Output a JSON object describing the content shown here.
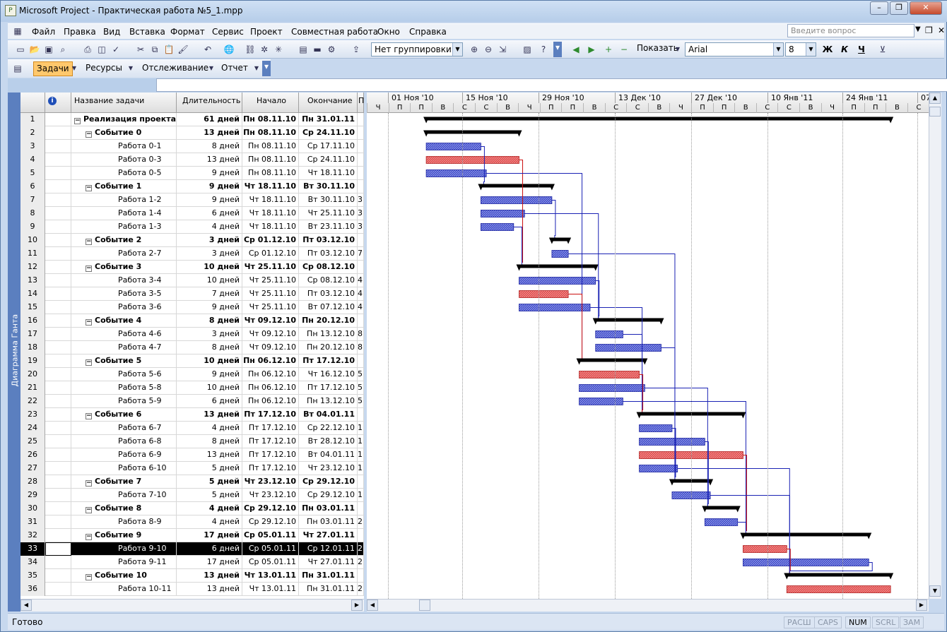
{
  "window": {
    "title": "Microsoft Project - Практическая работа №5_1.mpp",
    "min": "–",
    "restore": "❐",
    "close": "✕"
  },
  "menu": {
    "items": [
      "Файл",
      "Правка",
      "Вид",
      "Вставка",
      "Формат",
      "Сервис",
      "Проект",
      "Совместная работа",
      "Окно",
      "Справка"
    ],
    "help_placeholder": "Введите вопрос"
  },
  "toolbar": {
    "grouping": "Нет группировки",
    "show_label": "Показать",
    "font": "Arial",
    "size": "8",
    "bold": "Ж",
    "italic": "К",
    "underline": "Ч"
  },
  "toolbar2": {
    "tasks": "Задачи",
    "resources": "Ресурсы",
    "tracking": "Отслеживание",
    "report": "Отчет"
  },
  "side_label": "Диаграмма Ганта",
  "columns": {
    "info": "i",
    "name": "Название задачи",
    "duration": "Длительность",
    "start": "Начало",
    "finish": "Окончание",
    "pred": "П"
  },
  "timescale": {
    "weeks": [
      "01 Ноя '10",
      "15 Ноя '10",
      "29 Ноя '10",
      "13 Дек '10",
      "27 Дек '10",
      "10 Янв '11",
      "24 Янв '11",
      "07"
    ],
    "days": [
      "Ч",
      "П",
      "П",
      "В",
      "С",
      "С",
      "В",
      "Ч",
      "П",
      "П",
      "В",
      "С",
      "С",
      "В",
      "Ч",
      "П",
      "П",
      "В",
      "С",
      "С",
      "В",
      "Ч",
      "П",
      "П",
      "В",
      "С"
    ]
  },
  "tasks": [
    {
      "id": "1",
      "name": "Реализация проекта",
      "dur": "61 дней",
      "start": "Пн 08.11.10",
      "end": "Пн 31.01.11",
      "pred": "",
      "level": 0,
      "summary": true
    },
    {
      "id": "2",
      "name": "Событие 0",
      "dur": "13 дней",
      "start": "Пн 08.11.10",
      "end": "Ср 24.11.10",
      "pred": "",
      "level": 1,
      "summary": true
    },
    {
      "id": "3",
      "name": "Работа 0-1",
      "dur": "8 дней",
      "start": "Пн 08.11.10",
      "end": "Ср 17.11.10",
      "pred": "",
      "level": 2,
      "summary": false
    },
    {
      "id": "4",
      "name": "Работа 0-3",
      "dur": "13 дней",
      "start": "Пн 08.11.10",
      "end": "Ср 24.11.10",
      "pred": "",
      "level": 2,
      "summary": false
    },
    {
      "id": "5",
      "name": "Работа 0-5",
      "dur": "9 дней",
      "start": "Пн 08.11.10",
      "end": "Чт 18.11.10",
      "pred": "",
      "level": 2,
      "summary": false
    },
    {
      "id": "6",
      "name": "Событие 1",
      "dur": "9 дней",
      "start": "Чт 18.11.10",
      "end": "Вт 30.11.10",
      "pred": "",
      "level": 1,
      "summary": true
    },
    {
      "id": "7",
      "name": "Работа 1-2",
      "dur": "9 дней",
      "start": "Чт 18.11.10",
      "end": "Вт 30.11.10",
      "pred": "3",
      "level": 2,
      "summary": false
    },
    {
      "id": "8",
      "name": "Работа 1-4",
      "dur": "6 дней",
      "start": "Чт 18.11.10",
      "end": "Чт 25.11.10",
      "pred": "3",
      "level": 2,
      "summary": false
    },
    {
      "id": "9",
      "name": "Работа 1-3",
      "dur": "4 дней",
      "start": "Чт 18.11.10",
      "end": "Вт 23.11.10",
      "pred": "3",
      "level": 2,
      "summary": false
    },
    {
      "id": "10",
      "name": "Событие 2",
      "dur": "3 дней",
      "start": "Ср 01.12.10",
      "end": "Пт 03.12.10",
      "pred": "",
      "level": 1,
      "summary": true
    },
    {
      "id": "11",
      "name": "Работа 2-7",
      "dur": "3 дней",
      "start": "Ср 01.12.10",
      "end": "Пт 03.12.10",
      "pred": "7",
      "level": 2,
      "summary": false
    },
    {
      "id": "12",
      "name": "Событие 3",
      "dur": "10 дней",
      "start": "Чт 25.11.10",
      "end": "Ср 08.12.10",
      "pred": "",
      "level": 1,
      "summary": true
    },
    {
      "id": "13",
      "name": "Работа 3-4",
      "dur": "10 дней",
      "start": "Чт 25.11.10",
      "end": "Ср 08.12.10",
      "pred": "4",
      "level": 2,
      "summary": false
    },
    {
      "id": "14",
      "name": "Работа 3-5",
      "dur": "7 дней",
      "start": "Чт 25.11.10",
      "end": "Пт 03.12.10",
      "pred": "4",
      "level": 2,
      "summary": false
    },
    {
      "id": "15",
      "name": "Работа 3-6",
      "dur": "9 дней",
      "start": "Чт 25.11.10",
      "end": "Вт 07.12.10",
      "pred": "4",
      "level": 2,
      "summary": false
    },
    {
      "id": "16",
      "name": "Событие 4",
      "dur": "8 дней",
      "start": "Чт 09.12.10",
      "end": "Пн 20.12.10",
      "pred": "",
      "level": 1,
      "summary": true
    },
    {
      "id": "17",
      "name": "Работа 4-6",
      "dur": "3 дней",
      "start": "Чт 09.12.10",
      "end": "Пн 13.12.10",
      "pred": "8",
      "level": 2,
      "summary": false
    },
    {
      "id": "18",
      "name": "Работа 4-7",
      "dur": "8 дней",
      "start": "Чт 09.12.10",
      "end": "Пн 20.12.10",
      "pred": "8",
      "level": 2,
      "summary": false
    },
    {
      "id": "19",
      "name": "Событие 5",
      "dur": "10 дней",
      "start": "Пн 06.12.10",
      "end": "Пт 17.12.10",
      "pred": "",
      "level": 1,
      "summary": true
    },
    {
      "id": "20",
      "name": "Работа 5-6",
      "dur": "9 дней",
      "start": "Пн 06.12.10",
      "end": "Чт 16.12.10",
      "pred": "5",
      "level": 2,
      "summary": false
    },
    {
      "id": "21",
      "name": "Работа 5-8",
      "dur": "10 дней",
      "start": "Пн 06.12.10",
      "end": "Пт 17.12.10",
      "pred": "5",
      "level": 2,
      "summary": false
    },
    {
      "id": "22",
      "name": "Работа 5-9",
      "dur": "6 дней",
      "start": "Пн 06.12.10",
      "end": "Пн 13.12.10",
      "pred": "5",
      "level": 2,
      "summary": false
    },
    {
      "id": "23",
      "name": "Событие 6",
      "dur": "13 дней",
      "start": "Пт 17.12.10",
      "end": "Вт 04.01.11",
      "pred": "",
      "level": 1,
      "summary": true
    },
    {
      "id": "24",
      "name": "Работа 6-7",
      "dur": "4 дней",
      "start": "Пт 17.12.10",
      "end": "Ср 22.12.10",
      "pred": "1",
      "level": 2,
      "summary": false
    },
    {
      "id": "25",
      "name": "Работа 6-8",
      "dur": "8 дней",
      "start": "Пт 17.12.10",
      "end": "Вт 28.12.10",
      "pred": "1",
      "level": 2,
      "summary": false
    },
    {
      "id": "26",
      "name": "Работа 6-9",
      "dur": "13 дней",
      "start": "Пт 17.12.10",
      "end": "Вт 04.01.11",
      "pred": "1",
      "level": 2,
      "summary": false
    },
    {
      "id": "27",
      "name": "Работа 6-10",
      "dur": "5 дней",
      "start": "Пт 17.12.10",
      "end": "Чт 23.12.10",
      "pred": "1",
      "level": 2,
      "summary": false
    },
    {
      "id": "28",
      "name": "Событие 7",
      "dur": "5 дней",
      "start": "Чт 23.12.10",
      "end": "Ср 29.12.10",
      "pred": "",
      "level": 1,
      "summary": true
    },
    {
      "id": "29",
      "name": "Работа 7-10",
      "dur": "5 дней",
      "start": "Чт 23.12.10",
      "end": "Ср 29.12.10",
      "pred": "1",
      "level": 2,
      "summary": false
    },
    {
      "id": "30",
      "name": "Событие 8",
      "dur": "4 дней",
      "start": "Ср 29.12.10",
      "end": "Пн 03.01.11",
      "pred": "",
      "level": 1,
      "summary": true
    },
    {
      "id": "31",
      "name": "Работа 8-9",
      "dur": "4 дней",
      "start": "Ср 29.12.10",
      "end": "Пн 03.01.11",
      "pred": "2",
      "level": 2,
      "summary": false
    },
    {
      "id": "32",
      "name": "Событие 9",
      "dur": "17 дней",
      "start": "Ср 05.01.11",
      "end": "Чт 27.01.11",
      "pred": "",
      "level": 1,
      "summary": true
    },
    {
      "id": "33",
      "name": "Работа 9-10",
      "dur": "6 дней",
      "start": "Ср 05.01.11",
      "end": "Ср 12.01.11",
      "pred": "2",
      "level": 2,
      "summary": false,
      "selected": true
    },
    {
      "id": "34",
      "name": "Работа 9-11",
      "dur": "17 дней",
      "start": "Ср 05.01.11",
      "end": "Чт 27.01.11",
      "pred": "2",
      "level": 2,
      "summary": false
    },
    {
      "id": "35",
      "name": "Событие 10",
      "dur": "13 дней",
      "start": "Чт 13.01.11",
      "end": "Пн 31.01.11",
      "pred": "",
      "level": 1,
      "summary": true
    },
    {
      "id": "36",
      "name": "Работа 10-11",
      "dur": "13 дней",
      "start": "Чт 13.01.11",
      "end": "Пн 31.01.11",
      "pred": "2",
      "level": 2,
      "summary": false
    }
  ],
  "gantt_bars": [
    {
      "task": "1",
      "type": "summary",
      "start": "2010-11-08",
      "finish": "2011-01-31"
    },
    {
      "task": "2",
      "type": "summary",
      "start": "2010-11-08",
      "finish": "2010-11-24"
    },
    {
      "task": "3",
      "type": "normal",
      "start": "2010-11-08",
      "finish": "2010-11-17"
    },
    {
      "task": "4",
      "type": "critical",
      "start": "2010-11-08",
      "finish": "2010-11-24"
    },
    {
      "task": "5",
      "type": "normal",
      "start": "2010-11-08",
      "finish": "2010-11-18"
    },
    {
      "task": "6",
      "type": "summary",
      "start": "2010-11-18",
      "finish": "2010-11-30"
    },
    {
      "task": "7",
      "type": "normal",
      "start": "2010-11-18",
      "finish": "2010-11-30"
    },
    {
      "task": "8",
      "type": "normal",
      "start": "2010-11-18",
      "finish": "2010-11-25"
    },
    {
      "task": "9",
      "type": "normal",
      "start": "2010-11-18",
      "finish": "2010-11-23"
    },
    {
      "task": "10",
      "type": "summary",
      "start": "2010-12-01",
      "finish": "2010-12-03"
    },
    {
      "task": "11",
      "type": "normal",
      "start": "2010-12-01",
      "finish": "2010-12-03"
    },
    {
      "task": "12",
      "type": "summary",
      "start": "2010-11-25",
      "finish": "2010-12-08"
    },
    {
      "task": "13",
      "type": "normal",
      "start": "2010-11-25",
      "finish": "2010-12-08"
    },
    {
      "task": "14",
      "type": "critical",
      "start": "2010-11-25",
      "finish": "2010-12-03"
    },
    {
      "task": "15",
      "type": "normal",
      "start": "2010-11-25",
      "finish": "2010-12-07"
    },
    {
      "task": "16",
      "type": "summary",
      "start": "2010-12-09",
      "finish": "2010-12-20"
    },
    {
      "task": "17",
      "type": "normal",
      "start": "2010-12-09",
      "finish": "2010-12-13"
    },
    {
      "task": "18",
      "type": "normal",
      "start": "2010-12-09",
      "finish": "2010-12-20"
    },
    {
      "task": "19",
      "type": "summary",
      "start": "2010-12-06",
      "finish": "2010-12-17"
    },
    {
      "task": "20",
      "type": "critical",
      "start": "2010-12-06",
      "finish": "2010-12-16"
    },
    {
      "task": "21",
      "type": "normal",
      "start": "2010-12-06",
      "finish": "2010-12-17"
    },
    {
      "task": "22",
      "type": "normal",
      "start": "2010-12-06",
      "finish": "2010-12-13"
    },
    {
      "task": "23",
      "type": "summary",
      "start": "2010-12-17",
      "finish": "2011-01-04"
    },
    {
      "task": "24",
      "type": "normal",
      "start": "2010-12-17",
      "finish": "2010-12-22"
    },
    {
      "task": "25",
      "type": "normal",
      "start": "2010-12-17",
      "finish": "2010-12-28"
    },
    {
      "task": "26",
      "type": "critical",
      "start": "2010-12-17",
      "finish": "2011-01-04"
    },
    {
      "task": "27",
      "type": "normal",
      "start": "2010-12-17",
      "finish": "2010-12-23"
    },
    {
      "task": "28",
      "type": "summary",
      "start": "2010-12-23",
      "finish": "2010-12-29"
    },
    {
      "task": "29",
      "type": "normal",
      "start": "2010-12-23",
      "finish": "2010-12-29"
    },
    {
      "task": "30",
      "type": "summary",
      "start": "2010-12-29",
      "finish": "2011-01-03"
    },
    {
      "task": "31",
      "type": "normal",
      "start": "2010-12-29",
      "finish": "2011-01-03"
    },
    {
      "task": "32",
      "type": "summary",
      "start": "2011-01-05",
      "finish": "2011-01-27"
    },
    {
      "task": "33",
      "type": "critical",
      "start": "2011-01-05",
      "finish": "2011-01-12"
    },
    {
      "task": "34",
      "type": "normal",
      "start": "2011-01-05",
      "finish": "2011-01-27"
    },
    {
      "task": "35",
      "type": "summary",
      "start": "2011-01-13",
      "finish": "2011-01-31"
    },
    {
      "task": "36",
      "type": "critical",
      "start": "2011-01-13",
      "finish": "2011-01-31"
    }
  ],
  "colors": {
    "normal": "#3c48c8",
    "critical": "#e04848",
    "summary": "#000000",
    "link_blue": "#1a22b4",
    "link_red": "#cc1010"
  },
  "status": {
    "text": "Готово",
    "indicators": [
      "РАСШ",
      "CAPS",
      "NUM",
      "SCRL",
      "ЗАМ"
    ],
    "active": [
      "NUM"
    ]
  }
}
